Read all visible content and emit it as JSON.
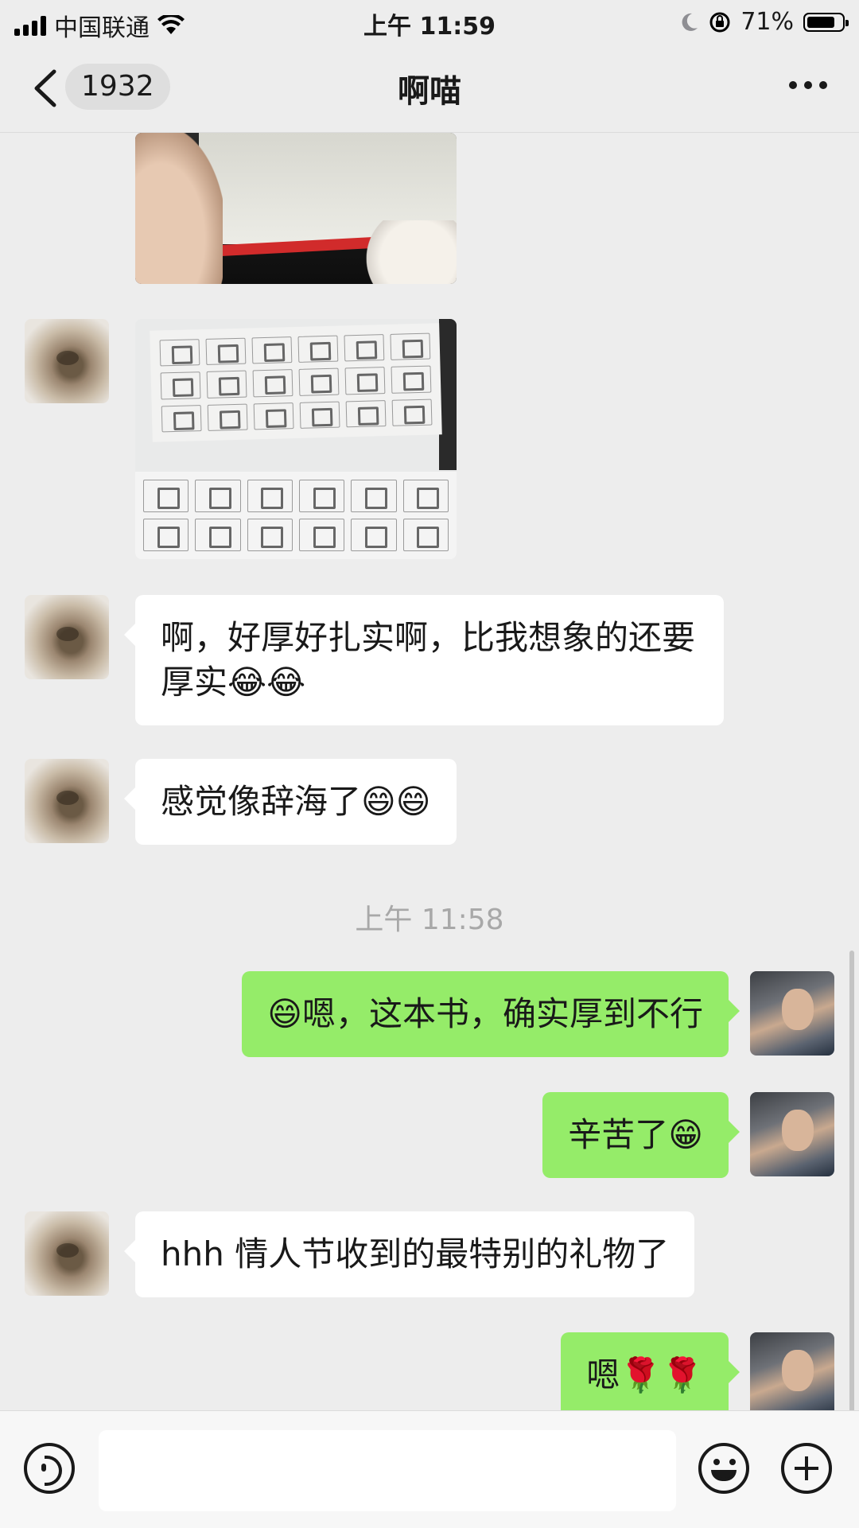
{
  "status_bar": {
    "carrier": "中国联通",
    "time": "上午 11:59",
    "battery": "71%"
  },
  "nav": {
    "unread_count": "1932",
    "title": "啊喵"
  },
  "messages": [
    {
      "side": "left",
      "type": "image",
      "content": "photo-book-edge"
    },
    {
      "side": "left",
      "type": "image",
      "content": "photo-character-pages"
    },
    {
      "side": "left",
      "type": "text",
      "text": "啊，好厚好扎实啊，比我想象的还要厚实😂😂"
    },
    {
      "side": "left",
      "type": "text",
      "text": "感觉像辞海了😄😄"
    },
    {
      "type": "timestamp",
      "text": "上午 11:58"
    },
    {
      "side": "right",
      "type": "text",
      "text": "😄嗯，这本书，确实厚到不行"
    },
    {
      "side": "right",
      "type": "text",
      "text": "辛苦了😁"
    },
    {
      "side": "left",
      "type": "text",
      "text": "hhh  情人节收到的最特别的礼物了"
    },
    {
      "side": "right",
      "type": "text",
      "text": "嗯🌹🌹"
    }
  ],
  "input": {
    "value": ""
  }
}
